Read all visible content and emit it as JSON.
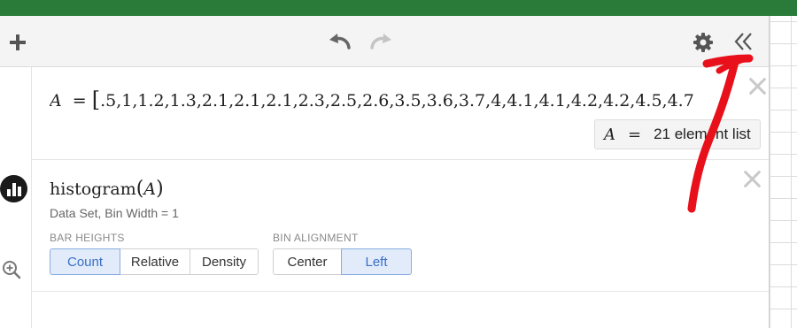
{
  "toolbar": {
    "icons": [
      "plus-icon",
      "undo-icon",
      "redo-icon",
      "gear-icon",
      "double-chevron-left-icon"
    ]
  },
  "expression1": {
    "variable": "A",
    "equals": "=",
    "open_bracket": "[",
    "list_values": ".5,1,1.2,1.3,2.1,2.1,2.1,2.3,2.5,2.6,3.5,3.6,3.7,4,4.1,4.1,4.2,4.2,4.5,4.7",
    "evaluation": {
      "lhs": "A",
      "eq": "=",
      "rhs": "21 element list"
    }
  },
  "expression2": {
    "function_name": "histogram",
    "open_paren": "(",
    "argument": "A",
    "close_paren": ")",
    "subtitle": "Data Set, Bin Width = 1",
    "bar_heights": {
      "label": "BAR HEIGHTS",
      "options": [
        "Count",
        "Relative",
        "Density"
      ],
      "selected": "Count"
    },
    "bin_alignment": {
      "label": "BIN ALIGNMENT",
      "options": [
        "Center",
        "Left"
      ],
      "selected": "Left"
    }
  },
  "gutter_icons": [
    "histogram-icon",
    "zoom-fit-icon"
  ],
  "colors": {
    "top_bar": "#2a7a3a",
    "selected_button_bg": "#e1ebfa",
    "selected_button_text": "#3a6fc6",
    "annotation": "#e8101a"
  }
}
